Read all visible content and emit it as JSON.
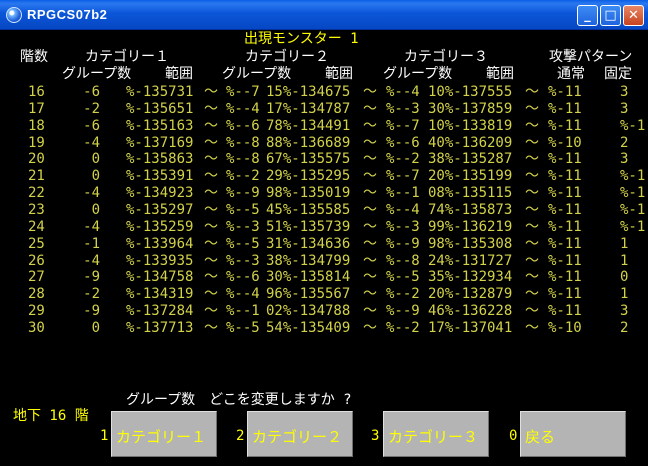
{
  "window": {
    "title": "RPGCS07b2",
    "min": "_",
    "max": "□",
    "close": "✕"
  },
  "screen_title": "出現モンスター 1",
  "headers": {
    "floor": "階数",
    "cat1": "カテゴリー１",
    "cat2": "カテゴリー２",
    "cat3": "カテゴリー３",
    "attack": "攻撃パターン",
    "group1": "グループ数",
    "range1": "範囲",
    "group2": "グループ数",
    "range2": "範囲",
    "group3": "グループ数",
    "range3": "範囲",
    "normal": "通常",
    "fixed": "固定"
  },
  "rows": [
    {
      "floor": "16",
      "g1": "-6",
      "r1": "%-135731",
      "g2": "%--7",
      "r2": "15%-134675",
      "g3": "%--4",
      "r3": "10%-137555",
      "atk": "%-11",
      "fix": "3"
    },
    {
      "floor": "17",
      "g1": "-2",
      "r1": "%-135651",
      "g2": "%--4",
      "r2": "17%-134787",
      "g3": "%--3",
      "r3": "30%-137859",
      "atk": "%-11",
      "fix": "3"
    },
    {
      "floor": "18",
      "g1": "-6",
      "r1": "%-135163",
      "g2": "%--6",
      "r2": "78%-134491",
      "g3": "%--7",
      "r3": "10%-133819",
      "atk": "%-11",
      "fix": "%-1"
    },
    {
      "floor": "19",
      "g1": "-4",
      "r1": "%-137169",
      "g2": "%--8",
      "r2": "88%-136689",
      "g3": "%--6",
      "r3": "40%-136209",
      "atk": "%-10",
      "fix": "2"
    },
    {
      "floor": "20",
      "g1": "0",
      "r1": "%-135863",
      "g2": "%--8",
      "r2": "67%-135575",
      "g3": "%--2",
      "r3": "38%-135287",
      "atk": "%-11",
      "fix": "3"
    },
    {
      "floor": "21",
      "g1": "0",
      "r1": "%-135391",
      "g2": "%--2",
      "r2": "29%-135295",
      "g3": "%--7",
      "r3": "20%-135199",
      "atk": "%-11",
      "fix": "%-1"
    },
    {
      "floor": "22",
      "g1": "-4",
      "r1": "%-134923",
      "g2": "%--9",
      "r2": "98%-135019",
      "g3": "%--1",
      "r3": "08%-135115",
      "atk": "%-11",
      "fix": "%-1"
    },
    {
      "floor": "23",
      "g1": "0",
      "r1": "%-135297",
      "g2": "%--5",
      "r2": "45%-135585",
      "g3": "%--4",
      "r3": "74%-135873",
      "atk": "%-11",
      "fix": "%-1"
    },
    {
      "floor": "24",
      "g1": "-4",
      "r1": "%-135259",
      "g2": "%--3",
      "r2": "51%-135739",
      "g3": "%--3",
      "r3": "99%-136219",
      "atk": "%-11",
      "fix": "%-1"
    },
    {
      "floor": "25",
      "g1": "-1",
      "r1": "%-133964",
      "g2": "%--5",
      "r2": "31%-134636",
      "g3": "%--9",
      "r3": "98%-135308",
      "atk": "%-11",
      "fix": "1"
    },
    {
      "floor": "26",
      "g1": "-4",
      "r1": "%-133935",
      "g2": "%--3",
      "r2": "38%-134799",
      "g3": "%--8",
      "r3": "24%-131727",
      "atk": "%-11",
      "fix": "1"
    },
    {
      "floor": "27",
      "g1": "-9",
      "r1": "%-134758",
      "g2": "%--6",
      "r2": "30%-135814",
      "g3": "%--5",
      "r3": "35%-132934",
      "atk": "%-11",
      "fix": "0"
    },
    {
      "floor": "28",
      "g1": "-2",
      "r1": "%-134319",
      "g2": "%--4",
      "r2": "96%-135567",
      "g3": "%--2",
      "r3": "20%-132879",
      "atk": "%-11",
      "fix": "1"
    },
    {
      "floor": "29",
      "g1": "-9",
      "r1": "%-137284",
      "g2": "%--1",
      "r2": "02%-134788",
      "g3": "%--9",
      "r3": "46%-136228",
      "atk": "%-11",
      "fix": "3"
    },
    {
      "floor": "30",
      "g1": "0",
      "r1": "%-137713",
      "g2": "%--5",
      "r2": "54%-135409",
      "g3": "%--2",
      "r3": "17%-137041",
      "atk": "%-10",
      "fix": "2"
    }
  ],
  "tilde": "～",
  "prompt": "グループ数　どこを変更しますか ?",
  "location": "地下 16 階",
  "options": [
    {
      "num": "1",
      "label": "カテゴリー１"
    },
    {
      "num": "2",
      "label": "カテゴリー２"
    },
    {
      "num": "3",
      "label": "カテゴリー３"
    },
    {
      "num": "0",
      "label": "戻る"
    }
  ]
}
